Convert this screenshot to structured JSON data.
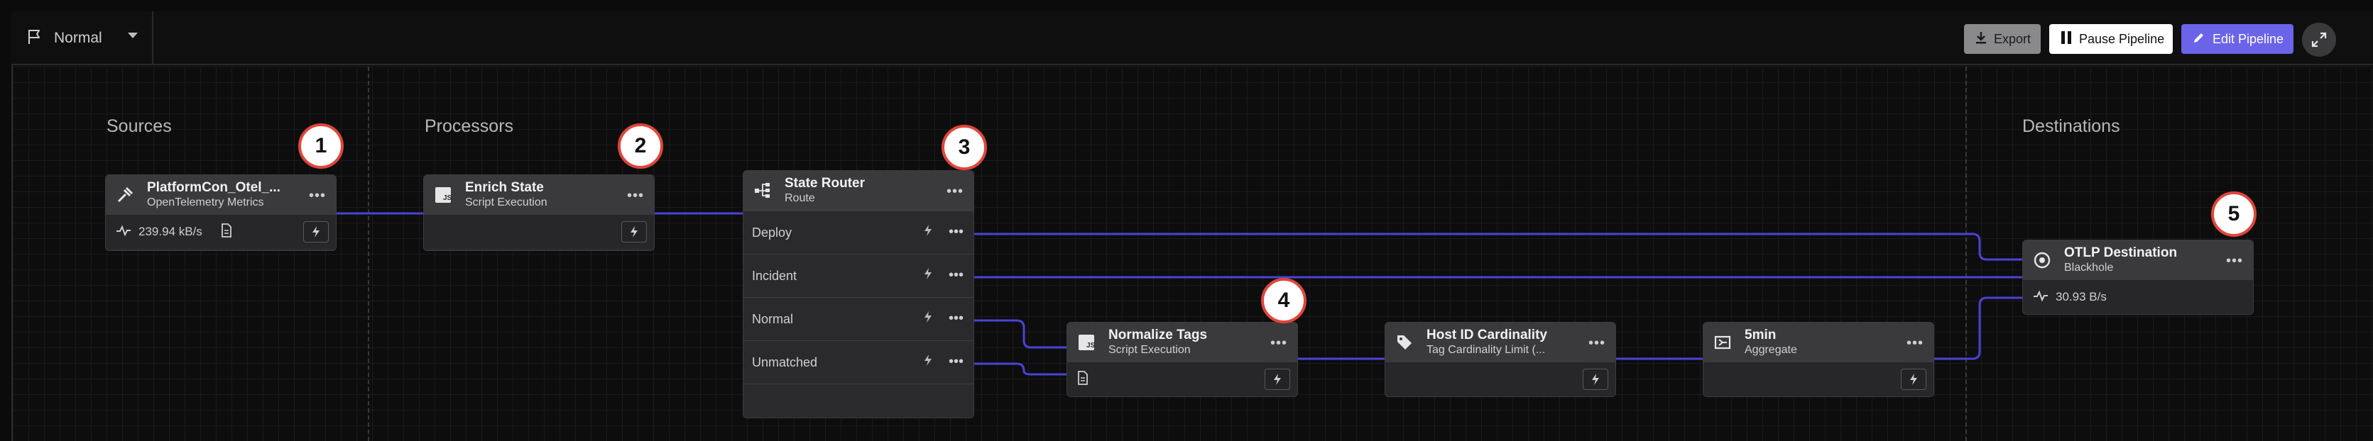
{
  "toolbar": {
    "selector_label": "Normal",
    "export_label": "Export",
    "pause_label": "Pause Pipeline",
    "edit_label": "Edit Pipeline"
  },
  "sections": {
    "sources": "Sources",
    "processors": "Processors",
    "destinations": "Destinations"
  },
  "nodes": {
    "source": {
      "title": "PlatformCon_Otel_...",
      "subtitle": "OpenTelemetry Metrics",
      "metric": "239.94 kB/s",
      "icon": "telemetry-icon"
    },
    "enrich": {
      "title": "Enrich State",
      "subtitle": "Script Execution",
      "icon": "js-icon"
    },
    "router": {
      "title": "State Router",
      "subtitle": "Route",
      "icon": "route-icon",
      "routes": [
        "Deploy",
        "Incident",
        "Normal",
        "Unmatched"
      ]
    },
    "normalize": {
      "title": "Normalize Tags",
      "subtitle": "Script Execution",
      "icon": "js-icon"
    },
    "hostid": {
      "title": "Host ID Cardinality",
      "subtitle": "Tag Cardinality Limit (...",
      "icon": "tag-icon"
    },
    "agg": {
      "title": "5min",
      "subtitle": "Aggregate",
      "icon": "aggregate-icon"
    },
    "dest": {
      "title": "OTLP Destination",
      "subtitle": "Blackhole",
      "metric": "30.93 B/s",
      "icon": "blackhole-icon"
    }
  },
  "badges": [
    "1",
    "2",
    "3",
    "4",
    "5"
  ],
  "colors": {
    "wire": "#4a43d6",
    "accent": "#6b63e8",
    "badge_border": "#e0463a"
  }
}
